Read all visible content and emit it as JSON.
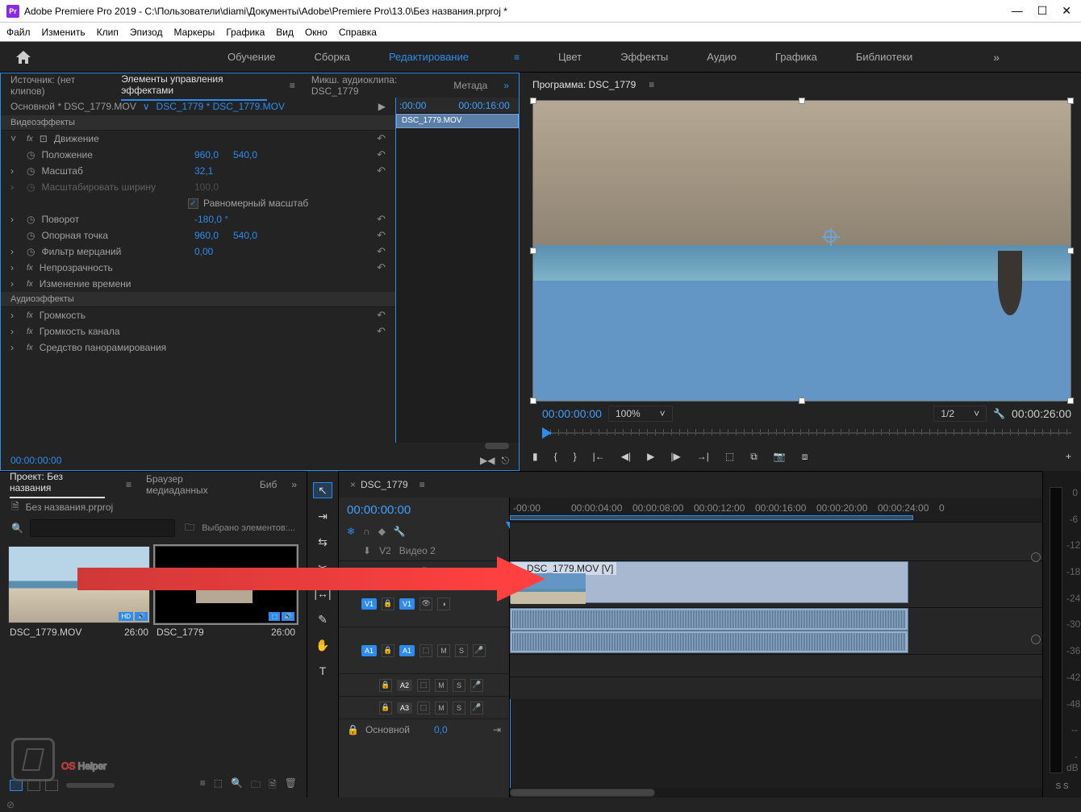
{
  "title": "Adobe Premiere Pro 2019 - C:\\Пользователи\\diami\\Документы\\Adobe\\Premiere Pro\\13.0\\Без названия.prproj *",
  "menu": [
    "Файл",
    "Изменить",
    "Клип",
    "Эпизод",
    "Маркеры",
    "Графика",
    "Вид",
    "Окно",
    "Справка"
  ],
  "workspaces": [
    "Обучение",
    "Сборка",
    "Редактирование",
    "Цвет",
    "Эффекты",
    "Аудио",
    "Графика",
    "Библиотеки"
  ],
  "ws_active": "Редактирование",
  "source_tabs": [
    "Источник: (нет клипов)",
    "Элементы управления эффектами",
    "Микш. аудиоклипа: DSC_1779",
    "Метада"
  ],
  "source_active": "Элементы управления эффектами",
  "eff_header": {
    "master": "Основной * DSC_1779.MOV",
    "clip": "DSC_1779 * DSC_1779.MOV"
  },
  "eff_ruler": [
    ":00:00",
    "00:00:16:00"
  ],
  "eff_tl_clip": "DSC_1779.MOV",
  "sections": {
    "video": "Видеоэффекты",
    "audio": "Аудиоэффекты"
  },
  "video_fx": {
    "motion": "Движение",
    "position": {
      "label": "Положение",
      "x": "960,0",
      "y": "540,0"
    },
    "scale": {
      "label": "Масштаб",
      "v": "32,1"
    },
    "scale_w": {
      "label": "Масштабировать ширину",
      "v": "100,0"
    },
    "uniform": "Равномерный масштаб",
    "rotation": {
      "label": "Поворот",
      "v": "-180,0 °"
    },
    "anchor": {
      "label": "Опорная точка",
      "x": "960,0",
      "y": "540,0"
    },
    "flicker": {
      "label": "Фильтр мерцаний",
      "v": "0,00"
    },
    "opacity": "Непрозрачность",
    "time": "Изменение времени"
  },
  "audio_fx": {
    "volume": "Громкость",
    "chvol": "Громкость канала",
    "pan": "Средство панорамирования"
  },
  "eff_footer_tc": "00:00:00:00",
  "program_tab": "Программа: DSC_1779",
  "prog_tc": "00:00:00:00",
  "prog_zoom": "100%",
  "prog_res": "1/2",
  "prog_dur": "00:00:26:00",
  "project": {
    "tabs": [
      "Проект: Без названия",
      "Браузер медиаданных",
      "Биб"
    ],
    "file": "Без названия.prproj",
    "selected": "Выбрано элементов:...",
    "items": [
      {
        "name": "DSC_1779.MOV",
        "dur": "26:00"
      },
      {
        "name": "DSC_1779",
        "dur": "26:00"
      }
    ]
  },
  "timeline": {
    "seq": "DSC_1779",
    "tc": "00:00:00:00",
    "v2": "V2",
    "vlabel": "Видео 2",
    "ruler": [
      "-00:00",
      "00:00:04:00",
      "00:00:08:00",
      "00:00:12:00",
      "00:00:16:00",
      "00:00:20:00",
      "00:00:24:00",
      "0"
    ],
    "clip": "DSC_1779.MOV [V]",
    "tracks": {
      "v1": "V1",
      "a1": "A1",
      "a2": "A2",
      "a3": "A3"
    },
    "mix": {
      "label": "Основной",
      "v": "0,0"
    }
  },
  "meters": [
    "0",
    "-6",
    "-12",
    "-18",
    "-24",
    "-30",
    "-36",
    "-42",
    "-48",
    "--",
    "-dB"
  ],
  "meter_solo": "S  S",
  "watermark": {
    "os": "OS",
    "helper": " Helper"
  }
}
